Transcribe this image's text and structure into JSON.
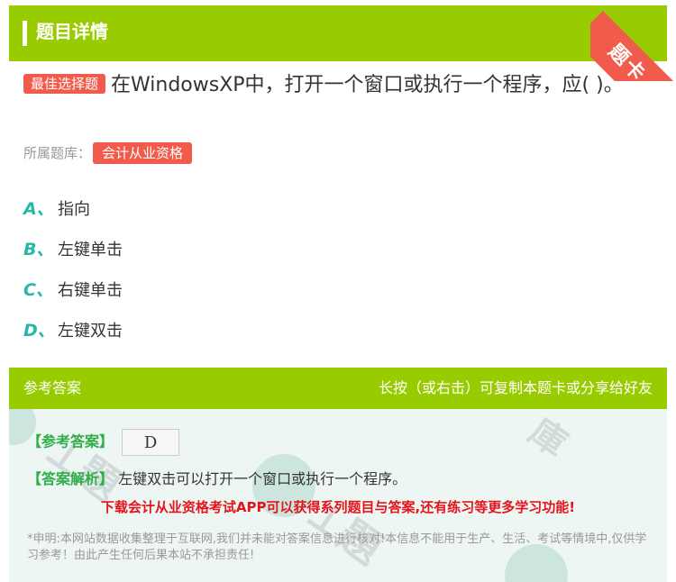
{
  "header": {
    "title": "题目详情"
  },
  "corner": {
    "label": "题卡"
  },
  "question": {
    "type_badge": "最佳选择题",
    "text": "在WindowsXP中，打开一个窗口或执行一个程序，应(    )。"
  },
  "bank": {
    "label": "所属题库：",
    "tag": "会计从业资格"
  },
  "options": [
    {
      "letter": "A、",
      "text": "指向"
    },
    {
      "letter": "B、",
      "text": "左键单击"
    },
    {
      "letter": "C、",
      "text": "右键单击"
    },
    {
      "letter": "D、",
      "text": "左键双击"
    }
  ],
  "answer_header": {
    "left": "参考答案",
    "right": "长按（或右击）可复制本题卡或分享给好友"
  },
  "answer": {
    "ref_label": "【参考答案】",
    "ref_value": "D",
    "analysis_label": "【答案解析】",
    "analysis_text": "左键双击可以打开一个窗口或执行一个程序。",
    "promo": "下载会计从业资格考试APP可以获得系列题目与答案,还有练习等更多学习功能!",
    "disclaimer": "*申明:本网站数据收集整理于互联网,我们并未能对答案信息进行核对!本信息不能用于生产、生活、考试等情境中,仅供学习参考！由此产生任何后果本站不承担责任!"
  },
  "colors": {
    "accent_green": "#99cc00",
    "badge_red": "#f25b4b",
    "option_teal": "#26b8a6",
    "promo_red": "#e4141a"
  }
}
